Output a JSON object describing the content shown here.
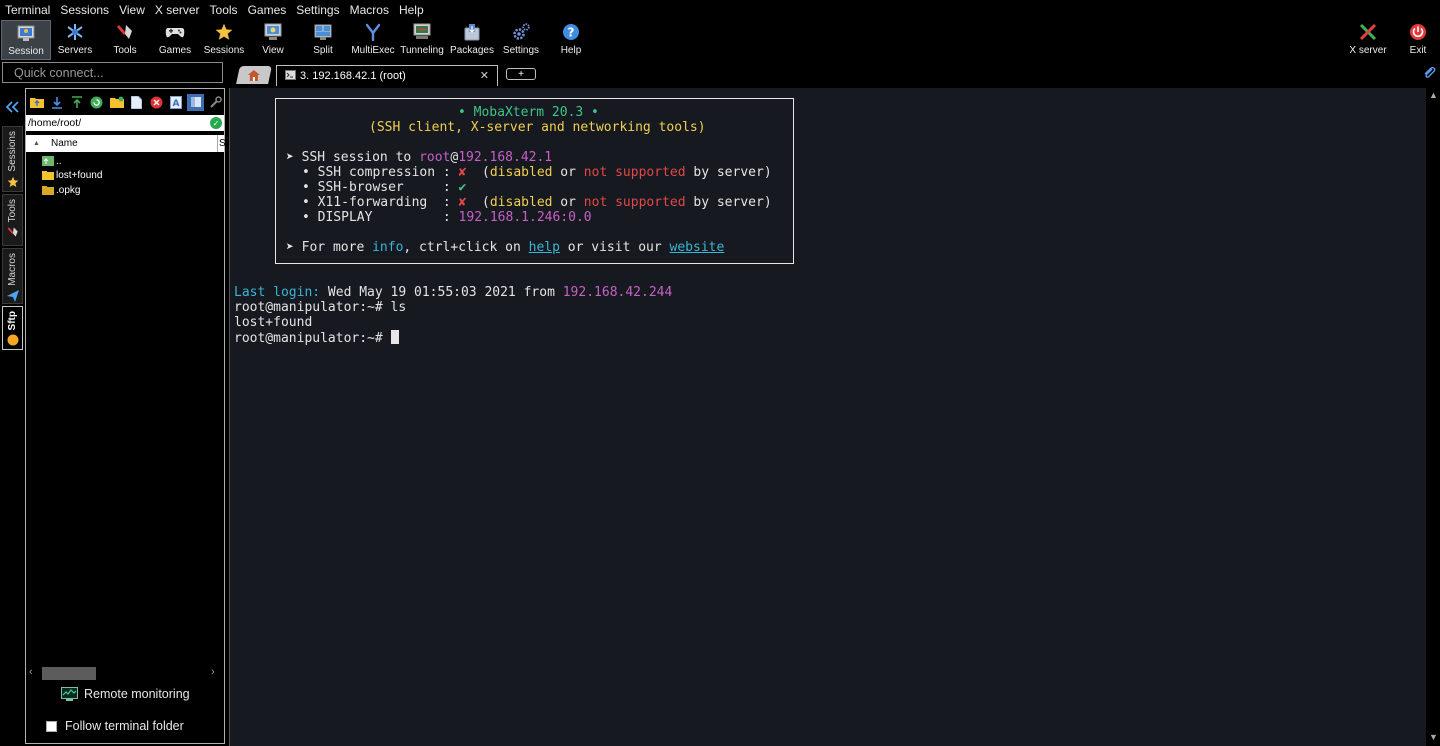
{
  "menubar": {
    "items": [
      "Terminal",
      "Sessions",
      "View",
      "X server",
      "Tools",
      "Games",
      "Settings",
      "Macros",
      "Help"
    ]
  },
  "toolbar": {
    "buttons": [
      {
        "label": "Session",
        "icon": "session-icon"
      },
      {
        "label": "Servers",
        "icon": "servers-icon"
      },
      {
        "label": "Tools",
        "icon": "tools-icon"
      },
      {
        "label": "Games",
        "icon": "gamepad-icon"
      },
      {
        "label": "Sessions",
        "icon": "star-icon"
      },
      {
        "label": "View",
        "icon": "view-icon"
      },
      {
        "label": "Split",
        "icon": "split-icon"
      },
      {
        "label": "MultiExec",
        "icon": "multiexec-icon"
      },
      {
        "label": "Tunneling",
        "icon": "tunneling-icon"
      },
      {
        "label": "Packages",
        "icon": "packages-icon"
      },
      {
        "label": "Settings",
        "icon": "settings-icon"
      },
      {
        "label": "Help",
        "icon": "help-icon"
      }
    ],
    "right_buttons": [
      {
        "label": "X server",
        "icon": "x-server-icon"
      },
      {
        "label": "Exit",
        "icon": "power-icon"
      }
    ]
  },
  "quick_connect": {
    "placeholder": "Quick connect..."
  },
  "tabs": {
    "session_label": "3. 192.168.42.1 (root)",
    "close": "✕",
    "add": "+"
  },
  "side_tabs": {
    "sessions": "Sessions",
    "tools": "Tools",
    "macros": "Macros",
    "sftp": "Sftp"
  },
  "sftp": {
    "path": "/home/root/",
    "columns": {
      "name": "Name",
      "size": "S"
    },
    "files": [
      {
        "name": "..",
        "type": "parent"
      },
      {
        "name": "lost+found",
        "type": "folder"
      },
      {
        "name": ".opkg",
        "type": "folder"
      }
    ],
    "remote_monitoring": "Remote monitoring",
    "follow_terminal_folder": "Follow terminal folder",
    "follow_checked": false
  },
  "terminal": {
    "banner": {
      "title": "• MobaXterm 20.3 •",
      "subtitle": "(SSH client, X-server and networking tools)",
      "session_prefix": "➤ SSH session to ",
      "session_user": "root",
      "session_at": "@",
      "session_host": "192.168.42.1",
      "bullet": "•",
      "compression_label": "SSH compression : ",
      "mark_x": "✘",
      "compression_note_open": "(",
      "disabled": "disabled",
      "or": " or ",
      "not_supported": "not supported",
      "by_server": " by server)",
      "browser_label": "SSH-browser     : ",
      "mark_check": "✔",
      "x11_label": "X11-forwarding  : ",
      "display_label": "DISPLAY         : ",
      "display_value": "192.168.1.246:0.0",
      "info_prefix": "➤ For more ",
      "info": "info",
      "info_mid": ", ctrl+click on ",
      "help": "help",
      "info_mid2": " or visit our ",
      "website": "website"
    },
    "last_login_label": "Last login:",
    "last_login_text": " Wed May 19 01:55:03 2021 from ",
    "last_login_host": "192.168.42.244",
    "prompt": "root@manipulator:~# ",
    "command": "ls",
    "output": "lost+found"
  }
}
